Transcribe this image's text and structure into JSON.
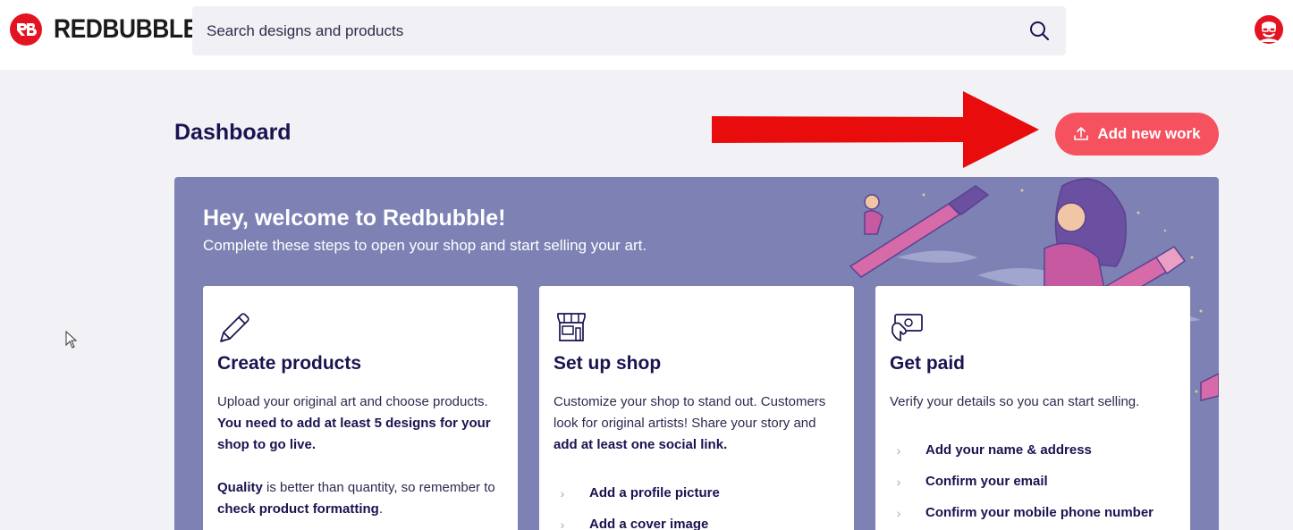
{
  "header": {
    "brand": "REDBUBBLE",
    "search": {
      "placeholder": "Search designs and products"
    }
  },
  "dashboard": {
    "title": "Dashboard",
    "add_button_label": "Add new work"
  },
  "welcome": {
    "title": "Hey, welcome to Redbubble!",
    "subtitle": "Complete these steps to open your shop and start selling your art."
  },
  "cards": [
    {
      "icon": "pencil-icon",
      "title": "Create products",
      "p1_text": "Upload your original art and choose products.",
      "p1_bold": "You need to add at least 5 designs for your shop to go live.",
      "p2_bold_a": "Quality",
      "p2_text_a": " is better than quantity, so remember to ",
      "p2_bold_b": "check product formatting",
      "p2_text_b": "."
    },
    {
      "icon": "shop-icon",
      "title": "Set up shop",
      "p1_text": "Customize your shop to stand out. Customers look for original artists! Share your story and ",
      "p1_bold": "add at least one social link.",
      "steps": [
        "Add a profile picture",
        "Add a cover image"
      ]
    },
    {
      "icon": "payment-icon",
      "title": "Get paid",
      "p1_text": "Verify your details so you can start selling.",
      "steps": [
        "Add your name & address",
        "Confirm your email",
        "Confirm your mobile phone number"
      ]
    }
  ],
  "colors": {
    "brand_red": "#e41321",
    "button_coral": "#f5515f",
    "banner_purple": "#7d81b4",
    "text_navy": "#191450"
  }
}
